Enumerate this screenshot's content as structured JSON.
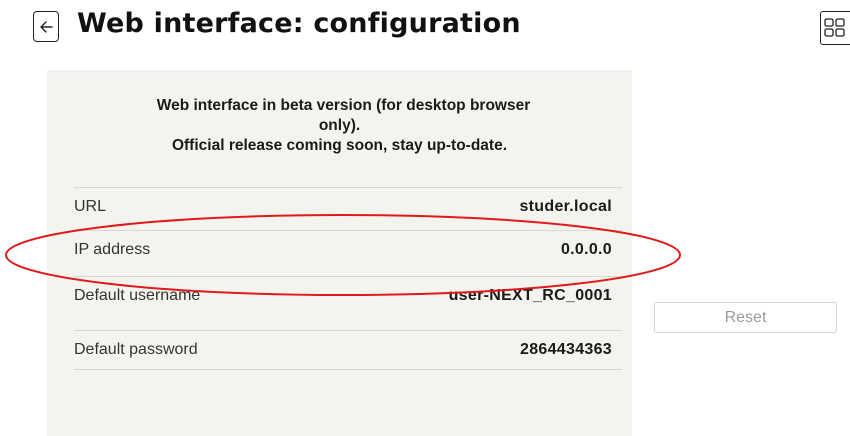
{
  "header": {
    "title": "Web interface: configuration",
    "back_icon": "arrow-left-icon",
    "grid_icon": "grid-icon"
  },
  "panel": {
    "notice_line1": "Web interface in beta version (for desktop browser",
    "notice_line2": "only).",
    "notice_line3": "Official release coming soon, stay up-to-date.",
    "rows": [
      {
        "label": "URL",
        "value": "studer.local"
      },
      {
        "label": "IP address",
        "value": "0.0.0.0"
      },
      {
        "label": "Default username",
        "value": "user-NEXT_RC_0001"
      },
      {
        "label": "Default password",
        "value": "2864434363"
      }
    ]
  },
  "actions": {
    "reset_label": "Reset"
  },
  "colors": {
    "panel_background": "#f4f4ef",
    "highlight": "#e0191c",
    "disabled_text": "#9a9a9a"
  }
}
